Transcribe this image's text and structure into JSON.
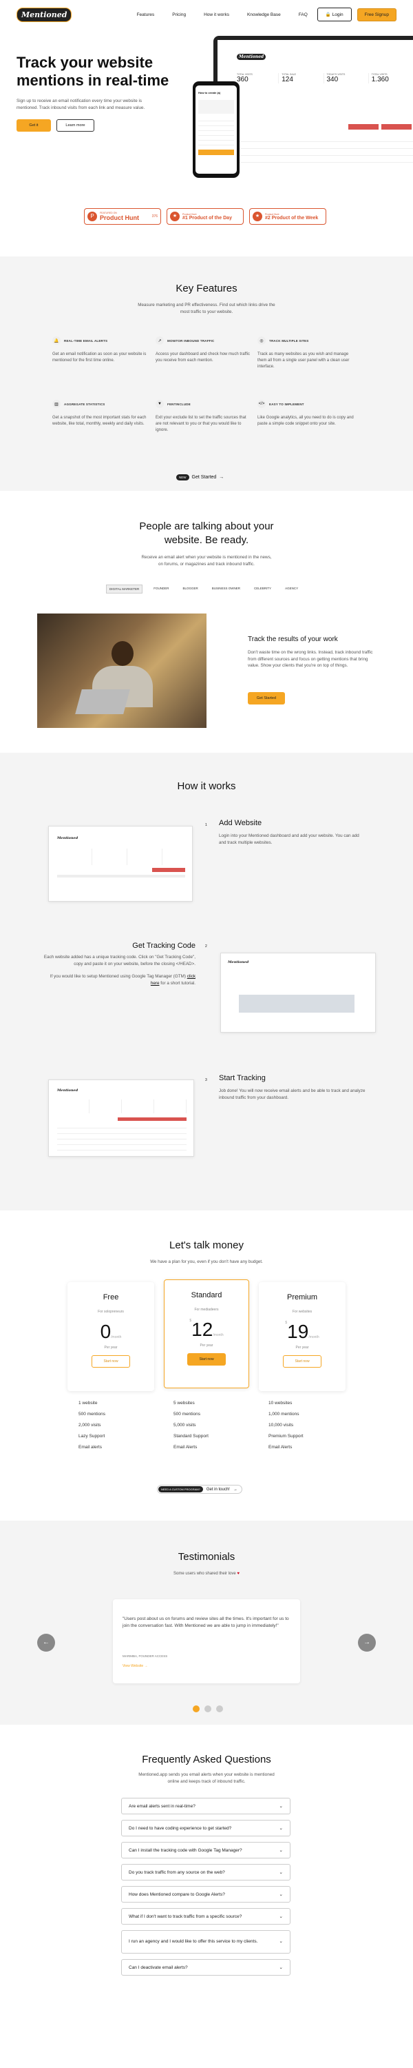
{
  "nav": {
    "logo": "Mentioned",
    "links": [
      "Features",
      "Pricing",
      "How it works",
      "Knowledge Base",
      "FAQ"
    ],
    "login": "Login",
    "signup": "Free Signup"
  },
  "hero": {
    "title_line1": "Track your website",
    "title_line2": "mentions in real-time",
    "description": "Sign up to receive an email notification every time your website is mentioned. Track inbound visits from each link and measure value.",
    "cta_primary": "Get it",
    "cta_secondary": "Learn more",
    "dashboard": {
      "stats": [
        {
          "label": "TOTAL VISITS",
          "value": "360"
        },
        {
          "label": "TOTAL SALE",
          "value": "124"
        },
        {
          "label": "TODAY'S VISITS",
          "value": "340"
        },
        {
          "label": "TOTAL VISITS",
          "value": "1.360"
        }
      ]
    },
    "phone": {
      "title": "How to create (a)"
    }
  },
  "badges": [
    {
      "top": "FEATURED ON",
      "main": "Product Hunt",
      "extra": "376"
    },
    {
      "top": "Product Hunt",
      "main": "#1 Product of the Day"
    },
    {
      "top": "Product Hunt",
      "main": "#2 Product of the Week"
    }
  ],
  "features": {
    "title": "Key Features",
    "subtitle": "Measure marketing and PR effectiveness. Find out which links drive the most traffic to your website.",
    "items": [
      {
        "icon": "bell-icon",
        "heading": "REAL-TIME EMAIL ALERTS",
        "text": "Get an email notification as soon as your website is mentioned for the first time online."
      },
      {
        "icon": "monitor-icon",
        "heading": "MONITOR INBOUND TRAFFIC",
        "text": "Access your dashboard and check how much traffic you receive from each mention."
      },
      {
        "icon": "sites-icon",
        "heading": "TRACK MULTIPLE SITES",
        "text": "Track as many websites as you wish and manage them all from a single user panel with a clean user interface."
      },
      {
        "icon": "stats-icon",
        "heading": "AGGREGATE STATISTICS",
        "text": "Get a snapshot of the most important stats for each website, like total, monthly, weekly and daily visits."
      },
      {
        "icon": "filter-icon",
        "heading": "FENTINCLUDE",
        "text": "Exit your exclude list to set the traffic sources that are not relevant to you or that you would like to ignore."
      },
      {
        "icon": "code-icon",
        "heading": "EASY TO IMPLEMENT",
        "text": "Like Google analytics, all you need to do is copy and paste a simple code snippet onto your site."
      }
    ],
    "cta_badge": "NEW",
    "cta": "Get Started"
  },
  "talk": {
    "title_line1": "People are talking about your",
    "title_line2": "website. Be ready.",
    "subtitle": "Receive an email alert when your website is mentioned in the news, on forums, or magazines and track inbound traffic.",
    "tabs": [
      "DIGITAL MARKETER",
      "FOUNDER",
      "BLOGGER",
      "BUSINESS OWNER",
      "CELEBRITY",
      "AGENCY"
    ],
    "card_title": "Track the results of your work",
    "card_text": "Don't waste time on the wrong links. Instead, track inbound traffic from different sources and focus on getting mentions that bring value. Show your clients that you're on top of things.",
    "card_cta": "Get Started"
  },
  "how": {
    "title": "How it works",
    "steps": [
      {
        "num": "1",
        "title": "Add Website",
        "text": "Login into your Mentioned dashboard and add your website. You can add and track multiple websites."
      },
      {
        "num": "2",
        "title": "Get Tracking Code",
        "text": "Each website added has a unique tracking code. Click on \"Get Tracking Code\", copy and paste it on your website, before the closing </HEAD>.",
        "text2": "If you would like to setup Mentioned using Google Tag Manager (GTM)",
        "link": "click here",
        "text3": "for a short tutorial."
      },
      {
        "num": "3",
        "title": "Start Tracking",
        "text": "Job done! You will now receive email alerts and be able to track and analyze inbound traffic from your dashboard."
      }
    ]
  },
  "pricing": {
    "title": "Let's talk money",
    "subtitle": "We have a plan for you, even if you don't have any budget.",
    "plans": [
      {
        "name": "Free",
        "for": "For solopreneurs",
        "price": "0",
        "per": "/month",
        "period": "Per year",
        "cta": "Start now",
        "features": [
          "1 website",
          "500 mentions",
          "2,000 visits",
          "Lazy Support",
          "Email alerts"
        ]
      },
      {
        "name": "Standard",
        "for": "For mediadeers",
        "price": "12",
        "per": "/month",
        "period": "Per year",
        "cta": "Start now",
        "features": [
          "5 websites",
          "500 mentions",
          "5,000 visits",
          "Standard Support",
          "Email Alerts"
        ]
      },
      {
        "name": "Premium",
        "for": "For websites",
        "price": "19",
        "per": "/month",
        "period": "Per year",
        "cta": "Start now",
        "features": [
          "10 websites",
          "1,000 mentions",
          "10,000 visits",
          "Premium Support",
          "Email Alerts"
        ]
      }
    ],
    "custom_badge": "NEED A CUSTOM PROGRAM?",
    "custom_cta": "Get in touch!"
  },
  "testimonials": {
    "title": "Testimonials",
    "subtitle": "Some users who shared their love",
    "quote": "\"Users post about us on forums and review sites all the times. It's important for us to join the conversation fast. With Mentioned we are able to jump in immediately!\"",
    "author": "MARIMBA, FOUNDER ACCESS",
    "link": "View Website",
    "prev": "←",
    "next": "→"
  },
  "faq": {
    "title": "Frequently Asked Questions",
    "subtitle": "Mentioned.app sends you email alerts when your website is mentioned online and keeps track of inbound traffic.",
    "questions": [
      "Are email alerts sent in real-time?",
      "Do I need to have coding experience to get started?",
      "Can I install the tracking code with Google Tag Manager?",
      "Do you track traffic from any source on the web?",
      "How does Mentioned compare to Google Alerts?",
      "What if I don't want to track traffic from a specific source?",
      "I run an agency and I would like to offer this service to my clients.",
      "Can I deactivate email alerts?"
    ]
  },
  "colors": {
    "accent": "#f5a623",
    "gray_bg": "#f4f4f4"
  }
}
